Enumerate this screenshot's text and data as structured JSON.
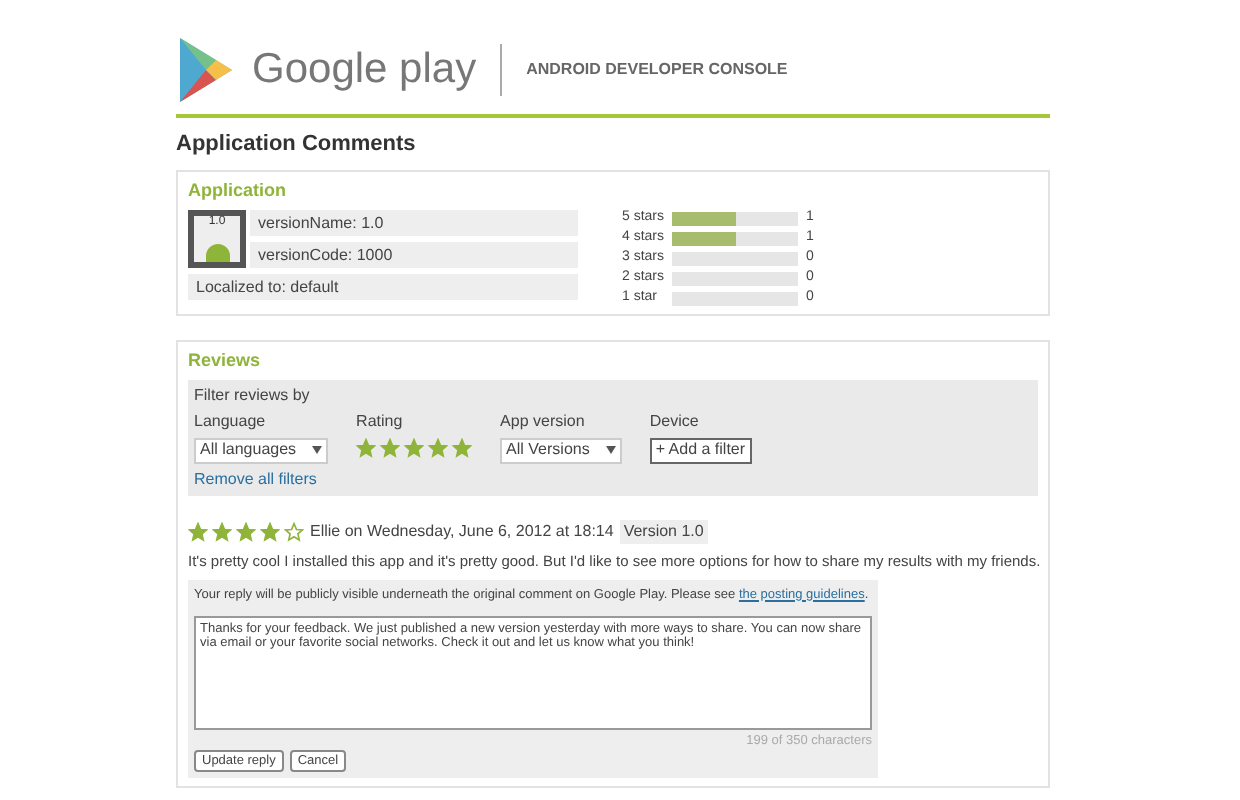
{
  "header": {
    "brand": "Google play",
    "console": "ANDROID DEVELOPER CONSOLE"
  },
  "page_title": "Application Comments",
  "application": {
    "title": "Application",
    "version_name": "versionName: 1.0",
    "version_code": "versionCode: 1000",
    "localized": "Localized to: default",
    "icon_label": "1.0",
    "ratings": [
      {
        "label": "5 stars",
        "level": 0.5,
        "count": "1"
      },
      {
        "label": "4 stars",
        "level": 0.5,
        "count": "1"
      },
      {
        "label": "3 stars",
        "level": 0,
        "count": "0"
      },
      {
        "label": "2 stars",
        "level": 0,
        "count": "0"
      },
      {
        "label": "1 star",
        "level": 0,
        "count": "0"
      }
    ]
  },
  "reviews": {
    "title": "Reviews",
    "filter_heading": "Filter reviews by",
    "filters": [
      {
        "kind": "select",
        "label": "Language",
        "value": "All languages"
      },
      {
        "kind": "stars",
        "label": "Rating",
        "stars": 5
      },
      {
        "kind": "select",
        "label": "App version",
        "value": "All Versions"
      },
      {
        "kind": "button",
        "label": "Device",
        "value": "+ Add a filter"
      }
    ],
    "remove_filters": "Remove all filters",
    "review": {
      "stars": 4,
      "byline": "Ellie on Wednesday, June 6, 2012 at 18:14",
      "version": "Version 1.0",
      "text": "It's pretty cool I installed this app and it's pretty good. But I'd like to see more options for how to share my results with my friends."
    },
    "reply": {
      "notice": "Your reply will be publicly visible underneath the original comment on Google Play. Please see",
      "link": "the posting guidelines",
      "notice_end": ".",
      "value": "Thanks for your feedback. We just published a new version yesterday with more ways to share. You can now share via email or your favorite social networks. Check it out and let us know what you think!",
      "counter": "199 of 350 characters",
      "buttons": [
        "Update reply",
        "Cancel"
      ]
    }
  }
}
